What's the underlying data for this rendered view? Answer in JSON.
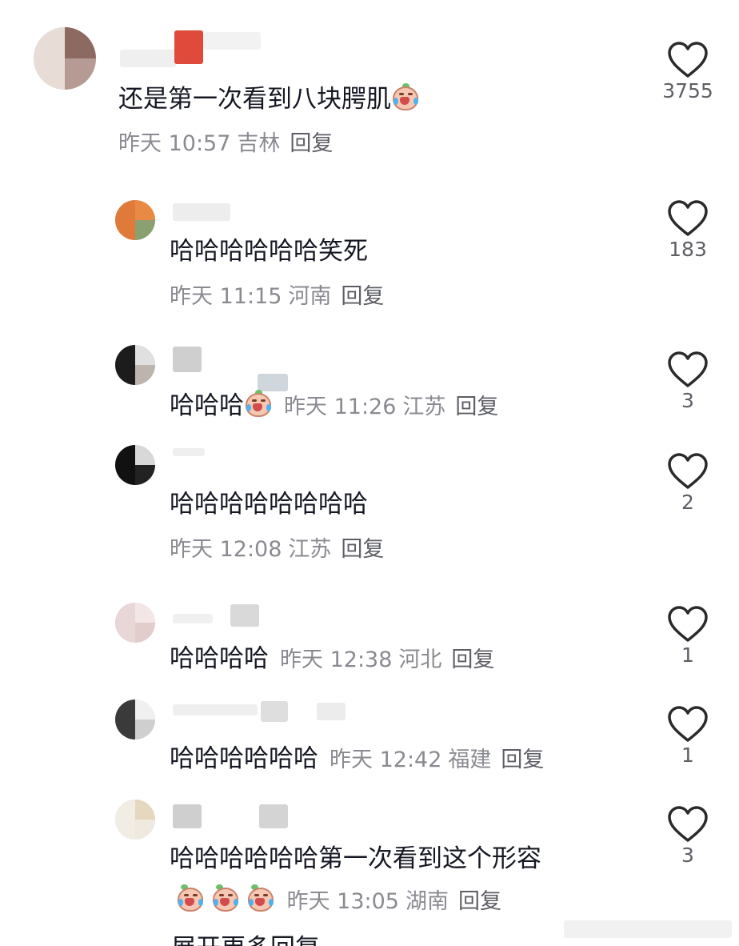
{
  "comments": [
    {
      "text": "还是第一次看到八块腭肌",
      "emoji": "crying-laugh-emoji",
      "time": "昨天 10:57",
      "location": "吉林",
      "reply": "回复",
      "likes": "3755"
    },
    {
      "text": "哈哈哈哈哈哈笑死",
      "time": "昨天 11:15",
      "location": "河南",
      "reply": "回复",
      "likes": "183"
    },
    {
      "text": "哈哈哈",
      "emoji": "crying-laugh-emoji",
      "time": "昨天 11:26",
      "location": "江苏",
      "reply": "回复",
      "likes": "3"
    },
    {
      "text": "哈哈哈哈哈哈哈哈",
      "time": "昨天 12:08",
      "location": "江苏",
      "reply": "回复",
      "likes": "2"
    },
    {
      "text": "哈哈哈哈",
      "time": "昨天 12:38",
      "location": "河北",
      "reply": "回复",
      "likes": "1"
    },
    {
      "text": "哈哈哈哈哈哈",
      "time": "昨天 12:42",
      "location": "福建",
      "reply": "回复",
      "likes": "1"
    },
    {
      "text": "哈哈哈哈哈哈第一次看到这个形容",
      "emoji": "crying-laugh-emoji",
      "time": "昨天 13:05",
      "location": "湖南",
      "reply": "回复",
      "likes": "3"
    }
  ],
  "bottom_peek_text": "展开更多回复",
  "icons": {
    "like": "heart-outline-icon"
  },
  "colors": {
    "text": "#161823",
    "meta": "#8a8b91",
    "reply": "#5e5f66",
    "heart_stroke": "#2a2a2a"
  }
}
